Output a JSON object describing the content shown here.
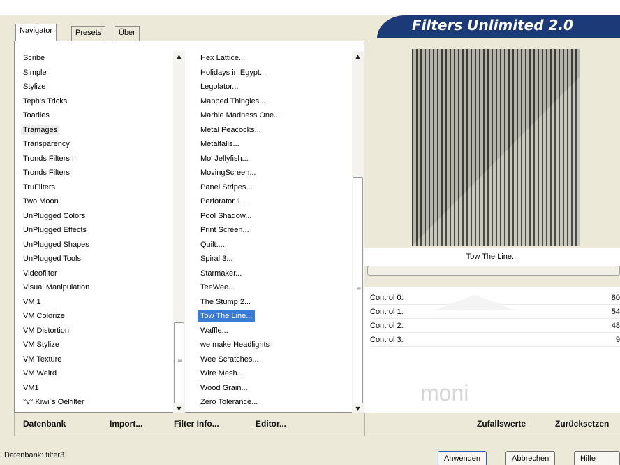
{
  "header": {
    "title": "Filters Unlimited 2.0"
  },
  "tabs": [
    {
      "label": "Navigator",
      "active": true
    },
    {
      "label": "Presets",
      "active": false
    },
    {
      "label": "Über",
      "active": false
    }
  ],
  "categories": [
    "Scribe",
    "Simple",
    "Stylize",
    "Teph's Tricks",
    "Toadies",
    "Tramages",
    "Transparency",
    "Tronds Filters II",
    "Tronds Filters",
    "TruFilters",
    "Two Moon",
    "UnPlugged Colors",
    "UnPlugged Effects",
    "UnPlugged Shapes",
    "UnPlugged Tools",
    "Videofilter",
    "Visual Manipulation",
    "VM 1",
    "VM Colorize",
    "VM Distortion",
    "VM Stylize",
    "VM Texture",
    "VM Weird",
    "VM1",
    "°v° Kiwi`s Oelfilter"
  ],
  "selected_category": "Tramages",
  "filters": [
    "Hex Lattice...",
    "Holidays in Egypt...",
    "Legolator...",
    "Mapped Thingies...",
    "Marble Madness One...",
    "Metal Peacocks...",
    "Metalfalls...",
    "Mo' Jellyfish...",
    "MovingScreen...",
    "Panel Stripes...",
    "Perforator 1...",
    "Pool Shadow...",
    "Print Screen...",
    "Quilt......",
    "Spiral 3...",
    "Starmaker...",
    "TeeWee...",
    "The Stump 2...",
    "Tow The Line...",
    "Waffle...",
    "we make Headlights",
    "Wee Scratches...",
    "Wire Mesh...",
    "Wood Grain...",
    "Zero Tolerance..."
  ],
  "selected_filter": "Tow The Line...",
  "left_buttons": {
    "datenbank": "Datenbank",
    "import": "Import...",
    "filter_info": "Filter Info...",
    "editor": "Editor..."
  },
  "preview": {
    "label": "Tow The Line..."
  },
  "controls": [
    {
      "label": "Control 0:",
      "value": "80"
    },
    {
      "label": "Control 1:",
      "value": "54"
    },
    {
      "label": "Control 2:",
      "value": "48"
    },
    {
      "label": "Control 3:",
      "value": "9"
    }
  ],
  "watermark": "moni",
  "right_buttons": {
    "random": "Zufallswerte",
    "reset": "Zurücksetzen"
  },
  "status": {
    "database": "Datenbank: filter3"
  },
  "dialog_buttons": {
    "apply": "Anwenden",
    "cancel": "Abbrechen",
    "help": "Hilfe"
  },
  "colors": {
    "banner": "#1c3a78",
    "selection": "#3a7bd5",
    "dialog_bg": "#ece9d8"
  }
}
